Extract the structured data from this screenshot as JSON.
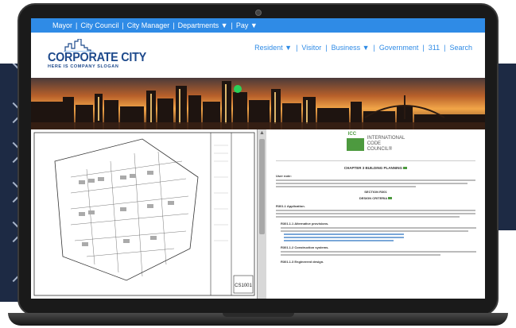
{
  "top_nav": {
    "items": [
      "Mayor",
      "City Council",
      "City Manager",
      "Departments ▼",
      "Pay ▼"
    ]
  },
  "logo": {
    "name": "CORPORATE CITY",
    "slogan": "HERE IS COMPANY SLOGAN"
  },
  "main_nav": {
    "items": [
      "Resident ▼",
      "Visitor",
      "Business ▼",
      "Government",
      "311",
      "Search"
    ]
  },
  "doc": {
    "org_logo_letters": "ICC",
    "org_name_lines": [
      "INTERNATIONAL",
      "CODE",
      "COUNCIL®"
    ],
    "chapter_title": "CHAPTER 3 BUILDING PLANNING",
    "user_note_label": "User note:",
    "section_heading": "SECTION R301",
    "section_subheading": "DESIGN CRITERIA",
    "subsection_1": "R301.1 Application.",
    "subsection_2": "R301.1.1 Alternative provisions.",
    "subsection_3": "R301.1.2 Construction systems.",
    "subsection_4": "R301.1.3 Engineered design."
  },
  "plan": {
    "sheet_label": "CS1001"
  },
  "colors": {
    "nav_blue": "#2f8be6",
    "logo_blue": "#1e4a8c",
    "icc_green": "#4d9a3f",
    "decor_navy": "#1d2a44"
  }
}
